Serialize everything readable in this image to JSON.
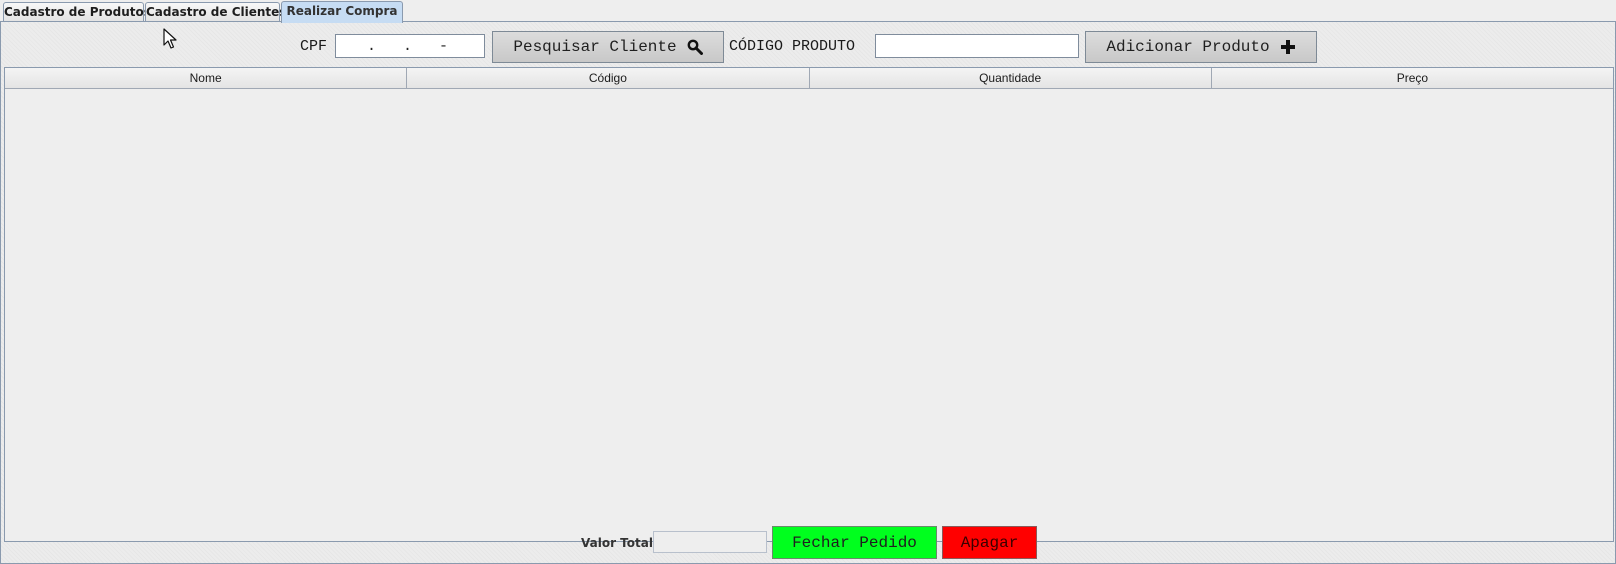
{
  "tabs": [
    {
      "label": "Cadastro de Produtos",
      "active": false
    },
    {
      "label": "Cadastro de Clientes",
      "active": false
    },
    {
      "label": "Realizar Compra",
      "active": true
    }
  ],
  "toolbar": {
    "cpf_label": "CPF",
    "cpf_value": "   .   .   -  ",
    "search_button_label": "Pesquisar Cliente",
    "search_button_icon": "search-icon",
    "codigo_label": "CÓDIGO PRODUTO",
    "codigo_value": "",
    "add_button_label": "Adicionar Produto",
    "add_button_icon": "plus-icon"
  },
  "table": {
    "columns": [
      "Nome",
      "Código",
      "Quantidade",
      "Preço"
    ],
    "rows": []
  },
  "footer": {
    "total_label": "Valor Total:",
    "total_value": "",
    "close_order_label": "Fechar Pedido",
    "delete_label": "Apagar"
  },
  "colors": {
    "active_tab": "#c6dcf3",
    "close_order_bg": "#00ff1e",
    "delete_bg": "#ff0000"
  }
}
